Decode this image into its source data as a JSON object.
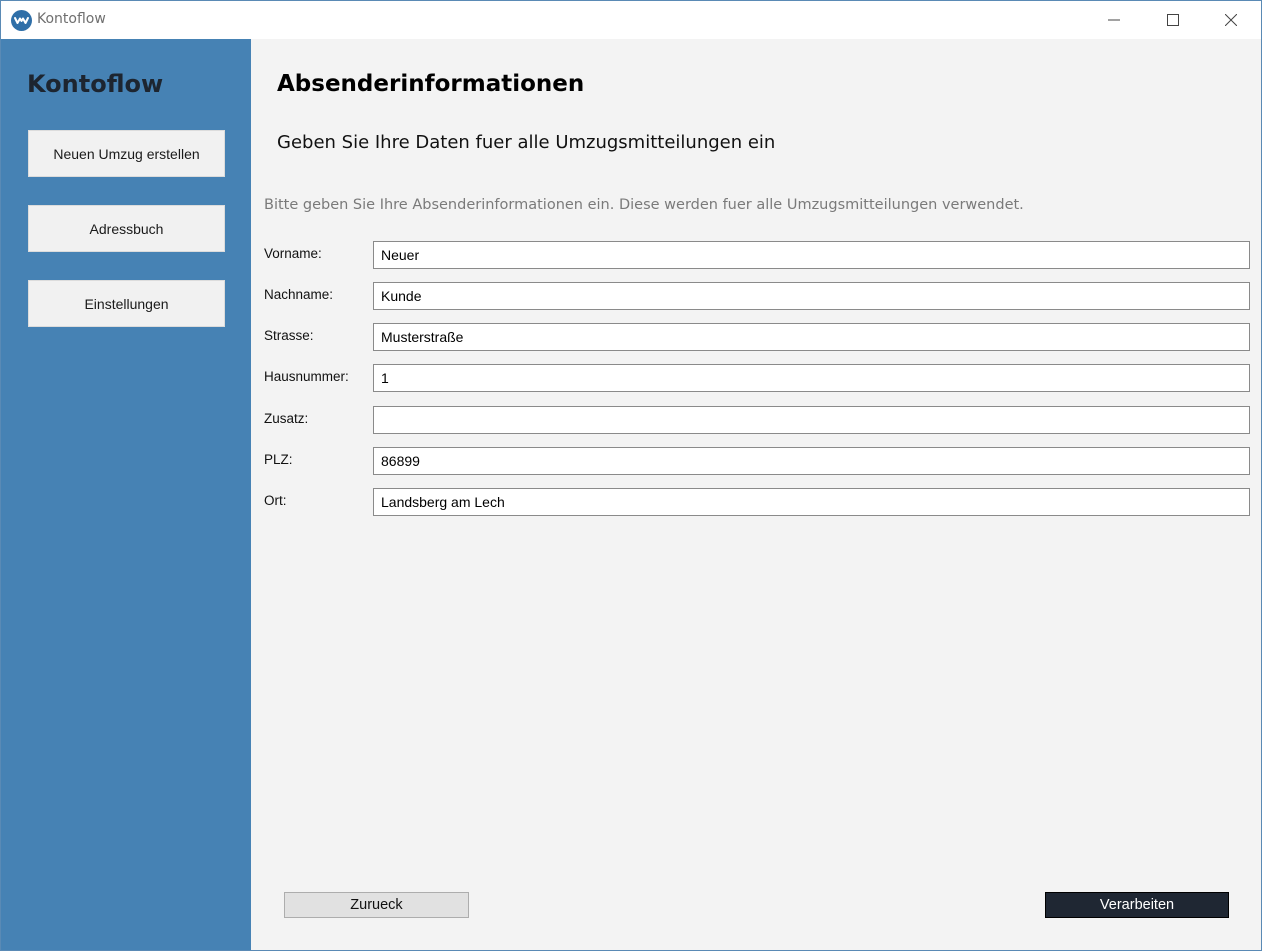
{
  "window": {
    "title": "Kontoflow",
    "icon": "kontoflow-logo-icon",
    "controls": [
      "minimize-icon",
      "maximize-icon",
      "close-icon"
    ]
  },
  "sidebar": {
    "brand": "Kontoflow",
    "items": [
      {
        "label": "Neuen Umzug erstellen"
      },
      {
        "label": "Adressbuch"
      },
      {
        "label": "Einstellungen"
      }
    ],
    "background": "#4682b4"
  },
  "main": {
    "title": "Absenderinformationen",
    "subtitle": "Geben Sie Ihre Daten fuer alle Umzugsmitteilungen ein",
    "hint": "Bitte geben Sie Ihre Absenderinformationen ein. Diese werden fuer alle Umzugsmitteilungen verwendet.",
    "fields": [
      {
        "label": "Vorname:",
        "value": "Neuer"
      },
      {
        "label": "Nachname:",
        "value": "Kunde"
      },
      {
        "label": "Strasse:",
        "value": "Musterstraße"
      },
      {
        "label": "Hausnummer:",
        "value": "1"
      },
      {
        "label": "Zusatz:",
        "value": ""
      },
      {
        "label": "PLZ:",
        "value": "86899"
      },
      {
        "label": "Ort:",
        "value": "Landsberg am Lech"
      }
    ],
    "back_label": "Zurueck",
    "process_label": "Verarbeiten"
  },
  "colors": {
    "accent": "#4682b4",
    "primary_button": "#1f2733"
  }
}
